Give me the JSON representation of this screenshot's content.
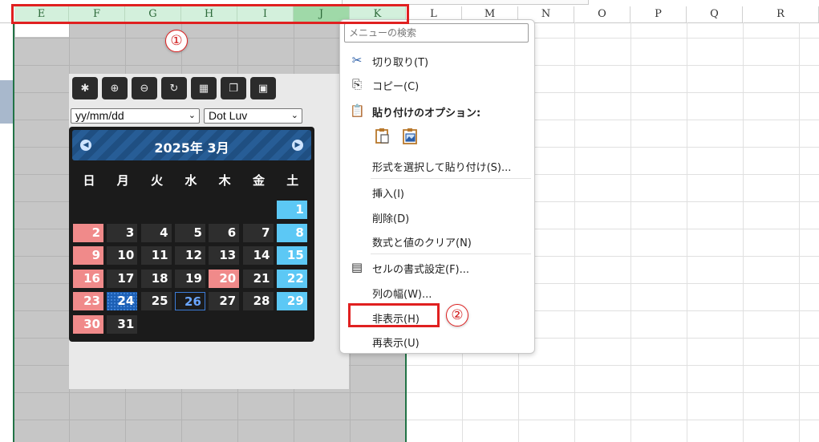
{
  "columns": [
    "E",
    "F",
    "G",
    "H",
    "I",
    "J",
    "K",
    "L",
    "M",
    "N",
    "O",
    "P",
    "Q",
    "R"
  ],
  "widget": {
    "toolbar_icons": [
      "gear-icon",
      "zoom-in-icon",
      "zoom-out-icon",
      "refresh-icon",
      "grid-icon",
      "copy-icon",
      "window-icon"
    ],
    "date_format": "yy/mm/dd",
    "theme": "Dot Luv",
    "calendar_title": "2025年 3月",
    "weekdays": [
      "日",
      "月",
      "火",
      "水",
      "木",
      "金",
      "土"
    ],
    "days": [
      "1",
      "2",
      "3",
      "4",
      "5",
      "6",
      "7",
      "8",
      "9",
      "10",
      "11",
      "12",
      "13",
      "14",
      "15",
      "16",
      "17",
      "18",
      "19",
      "20",
      "21",
      "22",
      "23",
      "24",
      "25",
      "26",
      "27",
      "28",
      "29",
      "30",
      "31"
    ]
  },
  "menu": {
    "search_placeholder": "メニューの検索",
    "cut": "切り取り(T)",
    "copy": "コピー(C)",
    "paste_options": "貼り付けのオプション:",
    "paste_special": "形式を選択して貼り付け(S)...",
    "insert": "挿入(I)",
    "delete": "削除(D)",
    "clear": "数式と値のクリア(N)",
    "format_cells": "セルの書式設定(F)...",
    "column_width": "列の幅(W)...",
    "hide": "非表示(H)",
    "unhide": "再表示(U)"
  },
  "annotations": {
    "step1": "①",
    "step2": "②"
  },
  "colors": {
    "selection_header": "#d3f0dc",
    "highlight": "#e02020",
    "sunday": "#f08a8a",
    "saturday": "#5cc8f5",
    "excel_green": "#217346"
  }
}
